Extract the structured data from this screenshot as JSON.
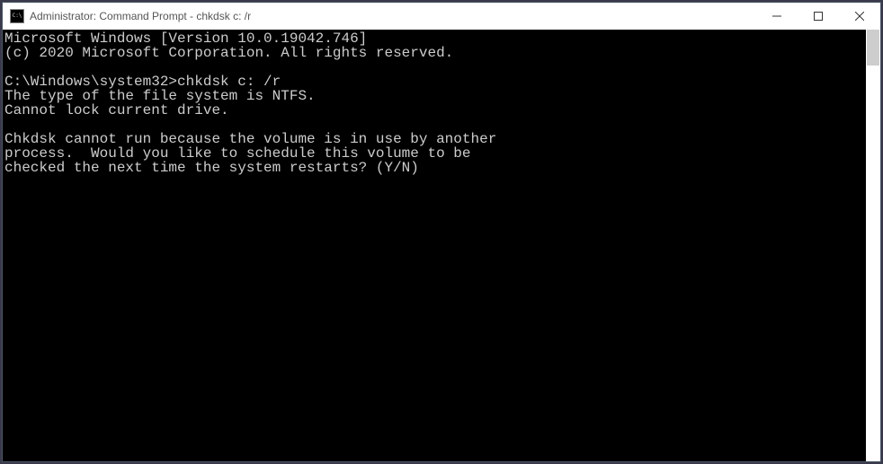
{
  "window": {
    "title": "Administrator: Command Prompt - chkdsk  c: /r",
    "icon_text": "C:\\"
  },
  "terminal": {
    "lines": [
      "Microsoft Windows [Version 10.0.19042.746]",
      "(c) 2020 Microsoft Corporation. All rights reserved.",
      "",
      "C:\\Windows\\system32>chkdsk c: /r",
      "The type of the file system is NTFS.",
      "Cannot lock current drive.",
      "",
      "Chkdsk cannot run because the volume is in use by another",
      "process.  Would you like to schedule this volume to be",
      "checked the next time the system restarts? (Y/N)"
    ]
  }
}
